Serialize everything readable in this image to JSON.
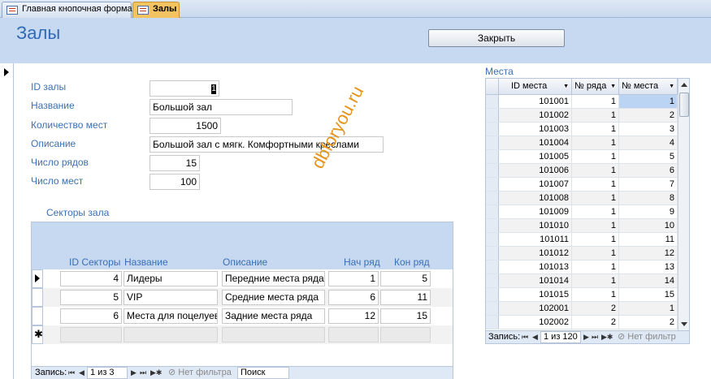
{
  "tabs": [
    {
      "label": "Главная кнопочная форма"
    },
    {
      "label": "Залы"
    }
  ],
  "header": {
    "title": "Залы",
    "close_label": "Закрыть"
  },
  "fields": {
    "id_label": "ID залы",
    "id_value": "1",
    "name_label": "Название",
    "name_value": "Большой зал",
    "seats_label": "Количество мест",
    "seats_value": "1500",
    "desc_label": "Описание",
    "desc_value": "Большой зал с мягк. Комфортными креслами",
    "rows_label": "Число рядов",
    "rows_value": "15",
    "places_label": "Число мест",
    "places_value": "100"
  },
  "sectors": {
    "caption": "Секторы зала",
    "headers": [
      "ID Секторы",
      "Название",
      "Описание",
      "Нач ряд",
      "Кон ряд"
    ],
    "rows": [
      [
        "4",
        "Лидеры",
        "Передние места ряда",
        "1",
        "5"
      ],
      [
        "5",
        "VIP",
        "Средние места ряда",
        "6",
        "11"
      ],
      [
        "6",
        "Места для поцелуев",
        "Задние места ряда",
        "12",
        "15"
      ]
    ],
    "nav": {
      "record_label": "Запись:",
      "counter": "1 из 3",
      "filter": "Нет фильтра",
      "search": "Поиск"
    }
  },
  "places": {
    "caption": "Места",
    "headers": [
      "ID места",
      "№ ряда",
      "№ места"
    ],
    "rows": [
      [
        "101001",
        "1",
        "1"
      ],
      [
        "101002",
        "1",
        "2"
      ],
      [
        "101003",
        "1",
        "3"
      ],
      [
        "101004",
        "1",
        "4"
      ],
      [
        "101005",
        "1",
        "5"
      ],
      [
        "101006",
        "1",
        "6"
      ],
      [
        "101007",
        "1",
        "7"
      ],
      [
        "101008",
        "1",
        "8"
      ],
      [
        "101009",
        "1",
        "9"
      ],
      [
        "101010",
        "1",
        "10"
      ],
      [
        "101011",
        "1",
        "11"
      ],
      [
        "101012",
        "1",
        "12"
      ],
      [
        "101013",
        "1",
        "13"
      ],
      [
        "101014",
        "1",
        "14"
      ],
      [
        "101015",
        "1",
        "15"
      ],
      [
        "102001",
        "2",
        "1"
      ],
      [
        "102002",
        "2",
        "2"
      ]
    ],
    "nav": {
      "record_label": "Запись:",
      "counter": "1 из 120",
      "filter": "Нет фильтр"
    }
  },
  "watermark": "dbforyou.ru",
  "colors": {
    "label_blue": "#3a6fb5",
    "header_band": "#c6d9f1",
    "active_tab": "#f3c261",
    "watermark": "#e4951a"
  }
}
